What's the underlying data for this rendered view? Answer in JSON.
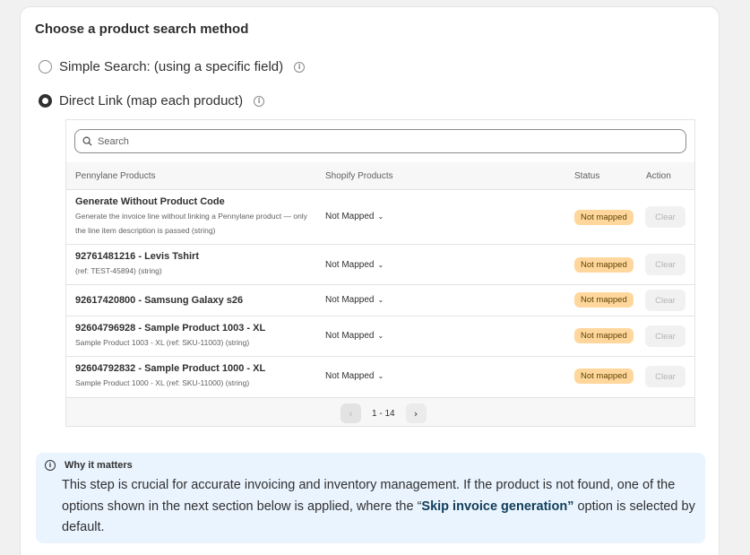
{
  "section": {
    "title": "Choose a product search method",
    "options": [
      {
        "label": "Simple Search: (using a specific field)",
        "checked": false
      },
      {
        "label": "Direct Link (map each product)",
        "checked": true
      }
    ]
  },
  "table": {
    "search_placeholder": "Search",
    "columns": [
      "Pennylane Products",
      "Shopify Products",
      "Status",
      "Action"
    ],
    "rows": [
      {
        "name": "Generate Without Product Code",
        "desc": "Generate the invoice line without linking a Pennylane product — only the line item description is passed (string)",
        "mapping": "Not Mapped",
        "status": "Not mapped",
        "action": "Clear"
      },
      {
        "name": "92761481216 - Levis Tshirt",
        "desc": "(ref: TEST-45894) (string)",
        "mapping": "Not Mapped",
        "status": "Not mapped",
        "action": "Clear"
      },
      {
        "name": "92617420800 - Samsung Galaxy s26",
        "desc": "",
        "mapping": "Not Mapped",
        "status": "Not mapped",
        "action": "Clear"
      },
      {
        "name": "92604796928 - Sample Product 1003 - XL",
        "desc": "Sample Product 1003 - XL (ref: SKU-11003) (string)",
        "mapping": "Not Mapped",
        "status": "Not mapped",
        "action": "Clear"
      },
      {
        "name": "92604792832 - Sample Product 1000 - XL",
        "desc": "Sample Product 1000 - XL (ref: SKU-11000) (string)",
        "mapping": "Not Mapped",
        "status": "Not mapped",
        "action": "Clear"
      }
    ],
    "pagination": {
      "label": "1 - 14",
      "prev_icon": "chevron-left-icon",
      "next_icon": "chevron-right-icon"
    }
  },
  "info": {
    "title": "Why it matters",
    "text_before": "This step is crucial for accurate invoicing and inventory management. If the product is not found, one of the options shown in the next section below is applied, where the “",
    "highlight": "Skip invoice generation”",
    "text_after": " option is selected by default."
  },
  "colors": {
    "badge_bg": "#ffd79d",
    "info_bg": "#eaf4ff",
    "highlight_text": "#103d57"
  }
}
